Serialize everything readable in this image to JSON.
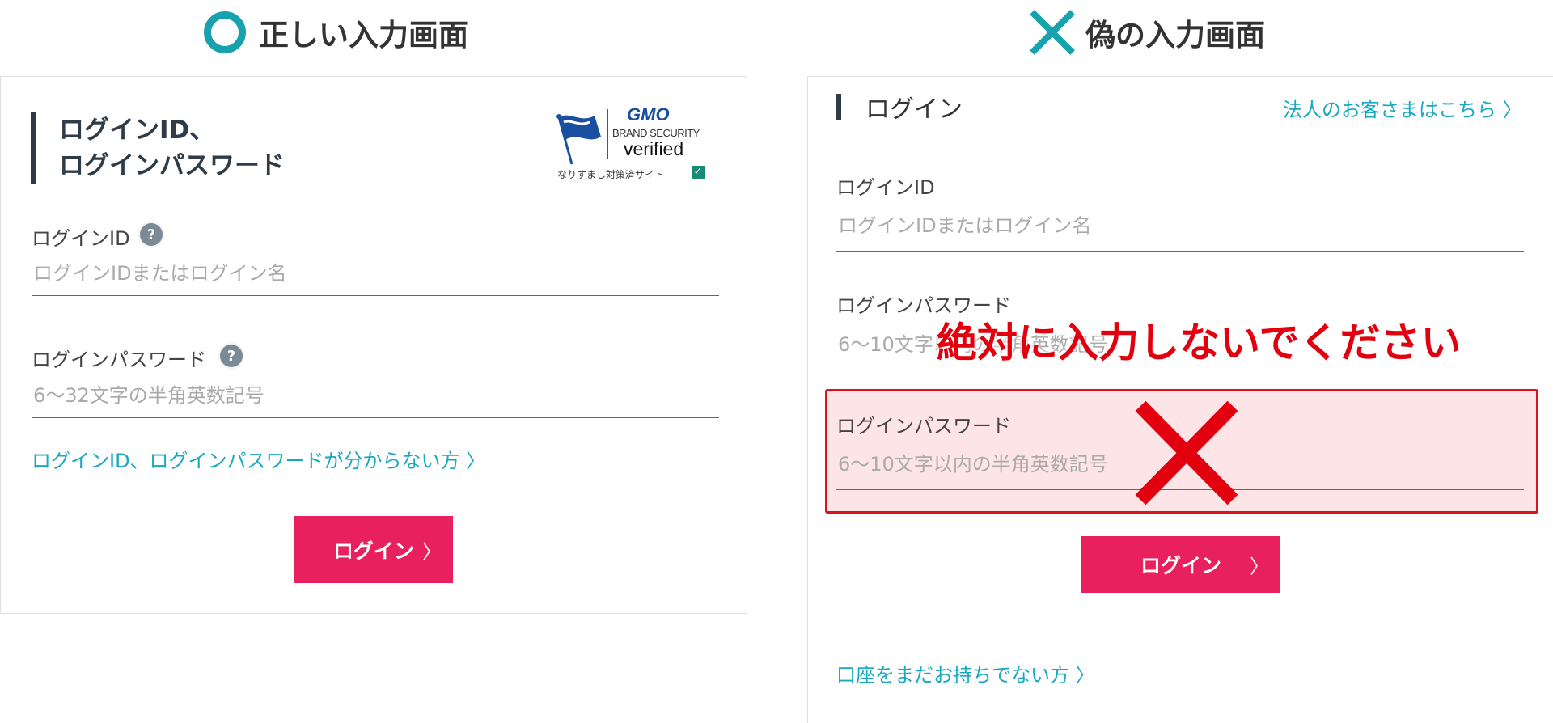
{
  "correct": {
    "heading": "正しい入力画面",
    "title_line1": "ログインID、",
    "title_line2": "ログインパスワード",
    "badge": {
      "brand": "GMO",
      "line1": "BRAND SECURITY",
      "line2": "verified",
      "line3": "なりすまし対策済サイト"
    },
    "id_label": "ログインID",
    "id_placeholder": "ログインIDまたはログイン名",
    "help": "?",
    "pw_label": "ログインパスワード",
    "pw_placeholder": "6〜32文字の半角英数記号",
    "forgot_link": "ログインID、ログインパスワードが分からない方 〉",
    "login_button": "ログイン",
    "chevron": "〉"
  },
  "fake": {
    "heading": "偽の入力画面",
    "title": "ログイン",
    "corporate_link": "法人のお客さまはこちら 〉",
    "id_label": "ログインID",
    "id_placeholder": "ログインIDまたはログイン名",
    "pw_label": "ログインパスワード",
    "pw_placeholder": "6〜10文字以内の半角英数記号",
    "pw2_label": "ログインパスワード",
    "pw2_placeholder": "6〜10文字以内の半角英数記号",
    "warning": "絶対に入力しないでください",
    "login_button": "ログイン",
    "chevron": "〉",
    "open_account_link": "口座をまだお持ちでない方 〉"
  },
  "colors": {
    "teal": "#17a2ad",
    "link": "#1aa8c1",
    "button": "#e8205e",
    "warning_red": "#e2000f",
    "warning_bg": "#fde4e6"
  }
}
